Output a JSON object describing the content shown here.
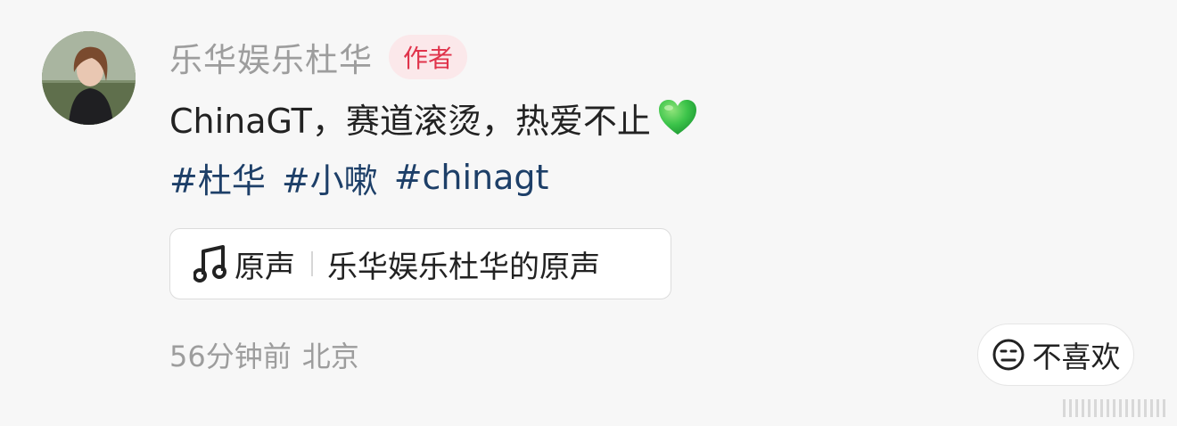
{
  "comment": {
    "author": {
      "name": "乐华娱乐杜华",
      "badge": "作者",
      "avatar_icon": "avatar-photo"
    },
    "text": "ChinaGT，赛道滚烫，热爱不止",
    "emoji": "green-heart-icon",
    "tags": [
      "#杜华",
      "#小嗽",
      "#chinagt"
    ],
    "music": {
      "icon": "music-note-icon",
      "label": "原声",
      "source": "乐华娱乐杜华的原声"
    },
    "meta": {
      "time": "56分钟前",
      "location": "北京"
    },
    "dislike": {
      "icon": "neutral-face-icon",
      "label": "不喜欢"
    }
  },
  "colors": {
    "background": "#f7f7f7",
    "author_name": "#9d9d9d",
    "badge_bg": "#fbe8ea",
    "badge_text": "#e0334b",
    "tag_text": "#1d3f68",
    "heart": "#3cc44a"
  }
}
